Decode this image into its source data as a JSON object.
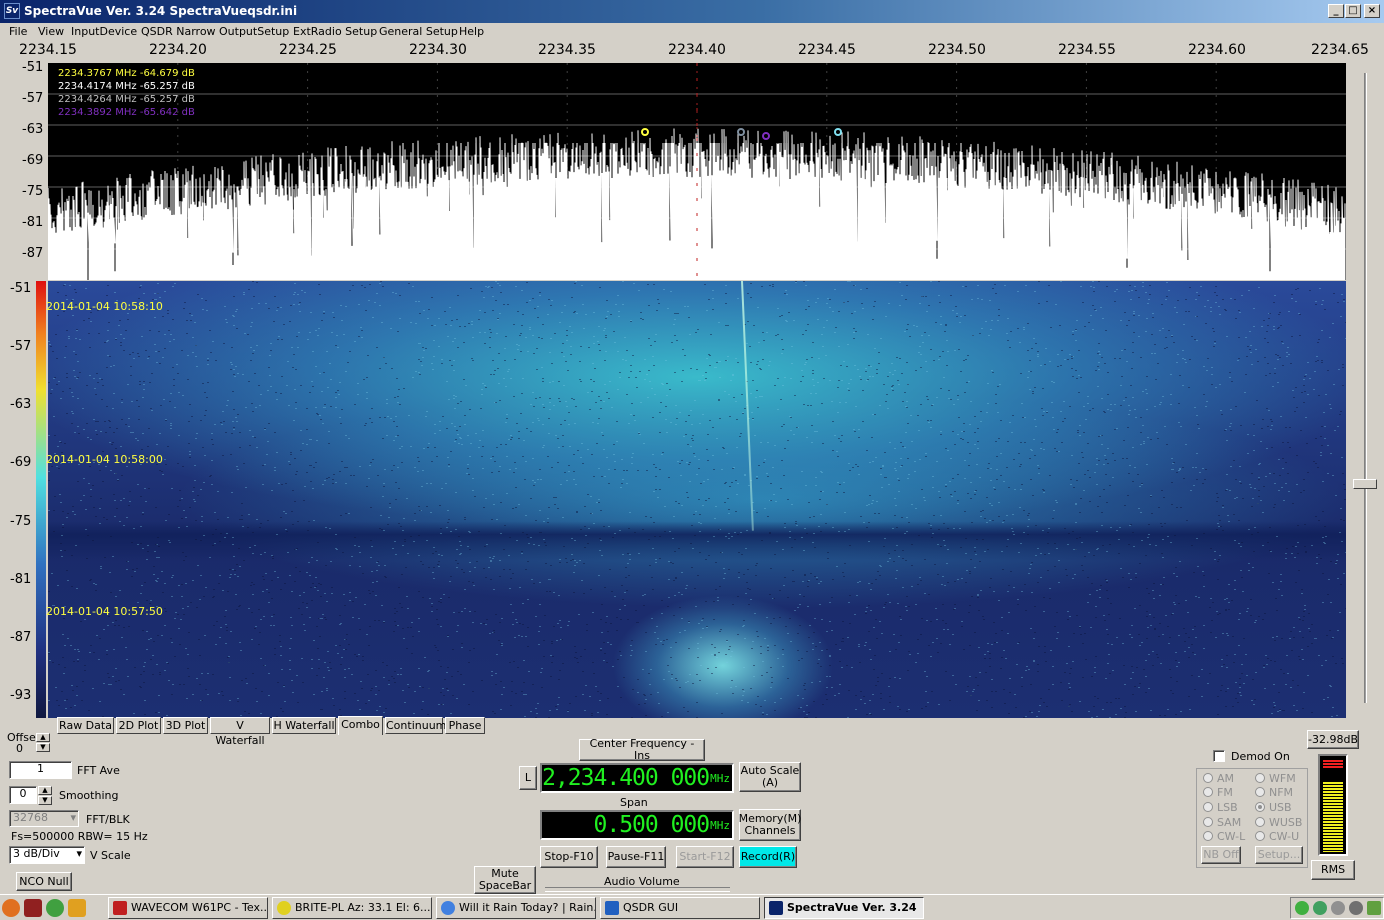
{
  "window": {
    "title": "SpectraVue Ver. 3.24  SpectraVueqsdr.ini",
    "icon": "Sv"
  },
  "menu": [
    "File",
    "View",
    "InputDevice",
    "QSDR Narrow",
    "OutputSetup",
    "ExtRadio Setup",
    "General Setup",
    "Help"
  ],
  "freq_axis": [
    "2234.15",
    "2234.20",
    "2234.25",
    "2234.30",
    "2234.35",
    "2234.40",
    "2234.45",
    "2234.50",
    "2234.55",
    "2234.60",
    "2234.65"
  ],
  "spectrum_db_axis": [
    "-51",
    "-57",
    "-63",
    "-69",
    "-75",
    "-81",
    "-87"
  ],
  "waterfall_db_axis": [
    "-51",
    "-57",
    "-63",
    "-69",
    "-75",
    "-81",
    "-87",
    "-93"
  ],
  "markers": [
    {
      "text": "2234.3767 MHz  -64.679  dB",
      "color": "#ffff40"
    },
    {
      "text": "2234.4174 MHz  -65.257  dB",
      "color": "#ffffff"
    },
    {
      "text": "2234.4264 MHz  -65.257  dB",
      "color": "#c0c0c0"
    },
    {
      "text": "2234.3892 MHz  -65.642  dB",
      "color": "#8030c0"
    }
  ],
  "waterfall_times": [
    "2014-01-04 10:58:10",
    "2014-01-04 10:58:00",
    "2014-01-04 10:57:50"
  ],
  "tabs": [
    "Raw Data",
    "2D Plot",
    "3D Plot",
    "V Waterfall",
    "H Waterfall",
    "Combo",
    "Continuum",
    "Phase"
  ],
  "active_tab": "Combo",
  "controls": {
    "offset_label": "Offset",
    "offset_value": "0",
    "fft_ave_value": "1",
    "fft_ave_label": "FFT Ave",
    "smoothing_value": "0",
    "smoothing_label": "Smoothing",
    "fft_blk_value": "32768",
    "fft_blk_label": "FFT/BLK",
    "fs_rbw": "Fs=500000 RBW=  15 Hz",
    "vscale_value": "3 dB/Div",
    "vscale_label": "V Scale",
    "nco_null": "NCO Null",
    "mute_line1": "Mute",
    "mute_line2": "SpaceBar"
  },
  "center": {
    "button": "Center Frequency - Ins",
    "l_button": "L",
    "freq": "2,234.400 000",
    "freq_unit": "MHz",
    "span_label": "Span",
    "span": "0.500 000",
    "span_unit": "MHz",
    "auto_scale_1": "Auto Scale",
    "auto_scale_2": "(A)",
    "memory_1": "Memory(M)",
    "memory_2": "Channels",
    "stop": "Stop-F10",
    "pause": "Pause-F11",
    "start": "Start-F12",
    "record": "Record(R)",
    "audio_volume": "Audio Volume"
  },
  "demod": {
    "checkbox_label": "Demod On",
    "modes_left": [
      "AM",
      "FM",
      "LSB",
      "SAM",
      "CW-L"
    ],
    "modes_right": [
      "WFM",
      "NFM",
      "USB",
      "WUSB",
      "CW-U"
    ],
    "selected": "USB",
    "nb_off": "NB Off",
    "setup": "Setup..."
  },
  "meter": {
    "readout": "-32.98dB",
    "rms": "RMS",
    "level_fraction": 0.85
  },
  "taskbar": [
    {
      "label": "WAVECOM W61PC - Tex...",
      "color": "#c02020"
    },
    {
      "label": "BRITE-PL  Az: 33.1 El: 6...",
      "color": "#e0d020"
    },
    {
      "label": "Will it Rain Today? | Rain...",
      "color": "#4080e0"
    },
    {
      "label": "QSDR GUI",
      "color": "#2060c0"
    },
    {
      "label": "SpectraVue Ver. 3.24",
      "color": "#0a246a"
    }
  ]
}
